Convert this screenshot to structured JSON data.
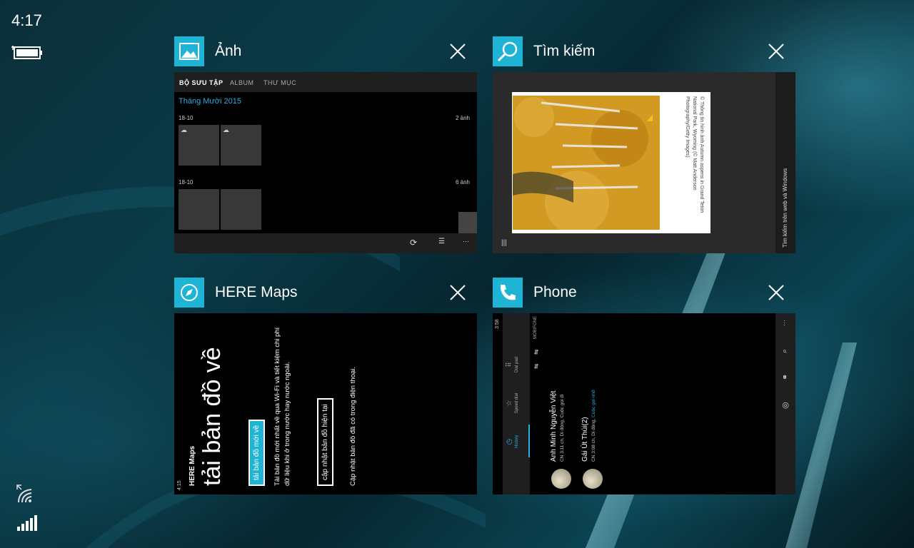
{
  "status": {
    "time": "4:17"
  },
  "photos": {
    "app_name": "Ảnh",
    "tabs": [
      "BỘ SƯU TẬP",
      "ALBUM",
      "THƯ MỤC"
    ],
    "month": "Tháng Mười 2015",
    "groups": [
      {
        "date": "18-10",
        "count": "2 ảnh"
      },
      {
        "date": "18-10",
        "count": "6 ảnh"
      }
    ],
    "more": "···"
  },
  "search": {
    "app_name": "Tìm kiếm",
    "caption": "© Thông tin hình ảnh Autumn aspens in Grand Teton National Park, Wyoming (© Matt Anderson Photography/Getty Images)",
    "side_text": "Tìm kiếm trên web và Windows"
  },
  "maps": {
    "app_name": "HERE Maps",
    "status_time": "4:15",
    "inner_app_name": "HERE Maps",
    "title": "tải bản đồ về",
    "download_button": "tải bản đồ mới về",
    "description": "Tải bản đồ mới nhất về qua Wi-Fi và tiết kiệm chi phí dữ liệu khi ở trong nước hay nước ngoài.",
    "update_button": "cập nhật bản đồ hiện tại",
    "note": "Cập nhật bản đồ đã có trong điện thoại."
  },
  "phone": {
    "app_name": "Phone",
    "status_time": "3:58",
    "tabs": [
      "History",
      "Speed dial",
      "Dial pad"
    ],
    "carrier": "MOBIFONE",
    "calls": [
      {
        "name": "Anh Minh Nguyễn Việt",
        "detail": "CN 3:11 ch, Di động, Cuộc gọi đi",
        "missed": ""
      },
      {
        "name": "Gái Út Thúi(2)",
        "detail": "CN 3:08 ch, Di động, ",
        "missed": "Cuộc gọi nhỡ"
      }
    ],
    "more": "···"
  }
}
